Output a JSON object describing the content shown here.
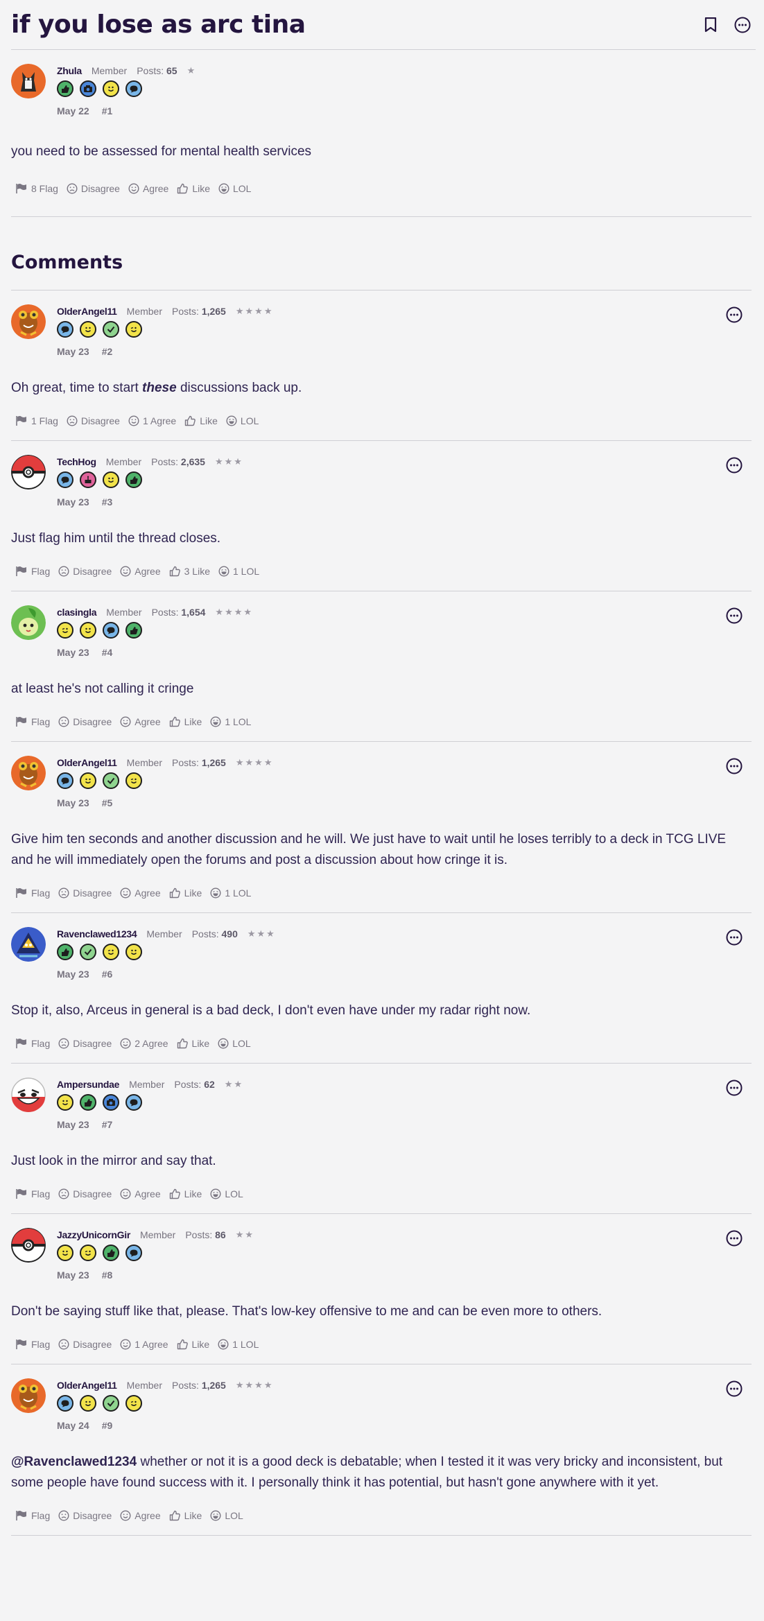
{
  "thread": {
    "title": "if you lose as arc tina"
  },
  "icons": {
    "bookmark": "bookmark-icon",
    "more": "more-icon",
    "flag": "flag-icon",
    "disagree": "disagree-icon",
    "agree": "agree-icon",
    "like": "like-icon",
    "lol": "lol-icon"
  },
  "comments_heading": "Comments",
  "posts": [
    {
      "user": "Zhula",
      "role": "Member",
      "posts_label": "Posts:",
      "posts": "65",
      "stars": "★",
      "badges": [
        "like",
        "photo",
        "smile",
        "chat"
      ],
      "date": "May 22",
      "num": "#1",
      "body": "you need to be assessed for mental health services",
      "flag": "8 Flag",
      "disagree": "Disagree",
      "agree": "Agree",
      "like": "Like",
      "lol": "LOL",
      "avatar": "zhula",
      "has_menu": false
    },
    {
      "user": "OlderAngel11",
      "role": "Member",
      "posts_label": "Posts:",
      "posts": "1,265",
      "stars": "★★★★",
      "badges": [
        "chat",
        "smile",
        "check",
        "wink"
      ],
      "date": "May 23",
      "num": "#2",
      "body_pre": "Oh great, time to start ",
      "body_em": "these",
      "body_post": " discussions back up.",
      "flag": "1 Flag",
      "disagree": "Disagree",
      "agree": "1 Agree",
      "like": "Like",
      "lol": "LOL",
      "avatar": "angel",
      "has_menu": true
    },
    {
      "user": "TechHog",
      "role": "Member",
      "posts_label": "Posts:",
      "posts": "2,635",
      "stars": "★★★",
      "badges": [
        "chat",
        "cake",
        "smile",
        "like"
      ],
      "date": "May 23",
      "num": "#3",
      "body": "Just flag him until the thread closes.",
      "flag": "Flag",
      "disagree": "Disagree",
      "agree": "Agree",
      "like": "3 Like",
      "lol": "1 LOL",
      "avatar": "pokeball",
      "has_menu": true
    },
    {
      "user": "clasingla",
      "role": "Member",
      "posts_label": "Posts:",
      "posts": "1,654",
      "stars": "★★★★",
      "badges": [
        "wink",
        "smile",
        "chat",
        "like"
      ],
      "date": "May 23",
      "num": "#4",
      "body": "at least he's not calling it cringe",
      "flag": "Flag",
      "disagree": "Disagree",
      "agree": "Agree",
      "like": "Like",
      "lol": "1 LOL",
      "avatar": "chikorita",
      "has_menu": true
    },
    {
      "user": "OlderAngel11",
      "role": "Member",
      "posts_label": "Posts:",
      "posts": "1,265",
      "stars": "★★★★",
      "badges": [
        "chat",
        "smile",
        "check",
        "wink"
      ],
      "date": "May 23",
      "num": "#5",
      "body": "Give him ten seconds and another discussion and he will. We just have to wait until he loses terribly to a deck in TCG LIVE and he will immediately open the forums and post a discussion about how cringe it is.",
      "flag": "Flag",
      "disagree": "Disagree",
      "agree": "Agree",
      "like": "Like",
      "lol": "1 LOL",
      "avatar": "angel",
      "has_menu": true
    },
    {
      "user": "Ravenclawed1234",
      "role": "Member",
      "posts_label": "Posts:",
      "posts": "490",
      "stars": "★★★",
      "badges": [
        "like",
        "check",
        "wink",
        "smile"
      ],
      "date": "May 23",
      "num": "#6",
      "body": "Stop it, also, Arceus in general is a bad deck, I don't even have under my radar right now.",
      "flag": "Flag",
      "disagree": "Disagree",
      "agree": "2 Agree",
      "like": "Like",
      "lol": "LOL",
      "avatar": "raven",
      "has_menu": true
    },
    {
      "user": "Ampersundae",
      "role": "Member",
      "posts_label": "Posts:",
      "posts": "62",
      "stars": "★★",
      "badges": [
        "smile",
        "like",
        "photo",
        "chat"
      ],
      "date": "May 23",
      "num": "#7",
      "body": "Just look in the mirror and say that.",
      "flag": "Flag",
      "disagree": "Disagree",
      "agree": "Agree",
      "like": "Like",
      "lol": "LOL",
      "avatar": "electrode",
      "has_menu": true
    },
    {
      "user": "JazzyUnicornGir",
      "role": "Member",
      "posts_label": "Posts:",
      "posts": "86",
      "stars": "★★",
      "badges": [
        "smile",
        "wink",
        "like",
        "chat"
      ],
      "date": "May 23",
      "num": "#8",
      "body": "Don't be saying stuff like that, please. That's low-key offensive to me and can be even more to others.",
      "flag": "Flag",
      "disagree": "Disagree",
      "agree": "1 Agree",
      "like": "Like",
      "lol": "1 LOL",
      "avatar": "pokeball",
      "has_menu": true
    },
    {
      "user": "OlderAngel11",
      "role": "Member",
      "posts_label": "Posts:",
      "posts": "1,265",
      "stars": "★★★★",
      "badges": [
        "chat",
        "smile",
        "check",
        "wink"
      ],
      "date": "May 24",
      "num": "#9",
      "mention": "@Ravenclawed1234",
      "body_post": " whether or not it is a good deck is debatable; when I tested it it was very bricky and inconsistent, but some people have found success with it. I personally think it has potential, but hasn't gone anywhere with it yet.",
      "flag": "Flag",
      "disagree": "Disagree",
      "agree": "Agree",
      "like": "Like",
      "lol": "LOL",
      "avatar": "angel",
      "has_menu": true
    }
  ]
}
